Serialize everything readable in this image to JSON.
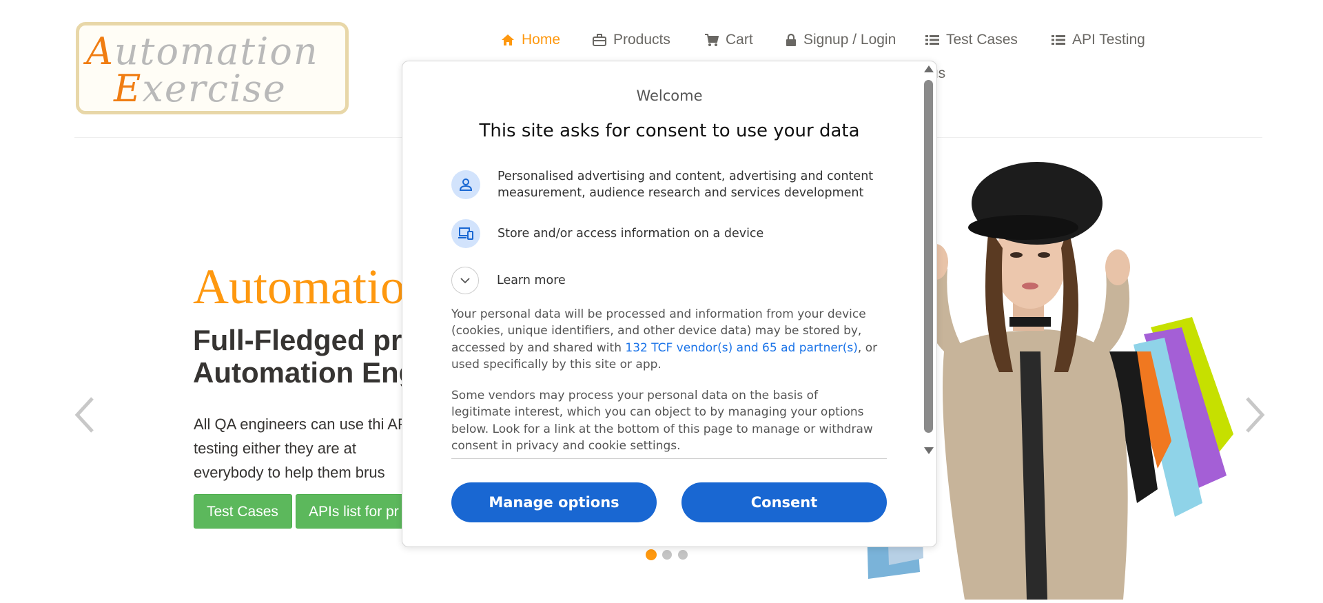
{
  "logo": {
    "line1_first": "A",
    "line1_rest": "utomation",
    "line2_first": "E",
    "line2_rest": "xercise"
  },
  "nav": {
    "items": [
      {
        "label": "Home",
        "icon": "home-icon"
      },
      {
        "label": "Products",
        "icon": "briefcase-icon"
      },
      {
        "label": "Cart",
        "icon": "cart-icon"
      },
      {
        "label": "Signup / Login",
        "icon": "lock-icon"
      },
      {
        "label": "Test Cases",
        "icon": "list-icon"
      },
      {
        "label": "API Testing",
        "icon": "list-icon"
      }
    ],
    "overflow_fragment": "us"
  },
  "hero": {
    "title": "Automatio",
    "subtitle": "Full-Fledged pra Automation Eng",
    "text": "All QA engineers can use thi API testing either they are at everybody to help them brus",
    "buttons": {
      "test_cases": "Test Cases",
      "apis_list": "APIs list for pr"
    }
  },
  "consent": {
    "welcome": "Welcome",
    "heading": "This site asks for consent to use your data",
    "purposes": [
      {
        "icon": "person-icon",
        "text": "Personalised advertising and content, advertising and content measurement, audience research and services development"
      },
      {
        "icon": "devices-icon",
        "text": "Store and/or access information on a device"
      }
    ],
    "learn_more": "Learn more",
    "para1_before": "Your personal data will be processed and information from your device (cookies, unique identifiers, and other device data) may be stored by, accessed by and shared with ",
    "para1_link": "132 TCF vendor(s) and 65 ad partner(s)",
    "para1_after": ", or used specifically by this site or app.",
    "para2": "Some vendors may process your personal data on the basis of legitimate interest, which you can object to by managing your options below. Look for a link at the bottom of this page to manage or withdraw consent in privacy and cookie settings.",
    "manage_button": "Manage options",
    "consent_button": "Consent"
  },
  "carousel": {
    "slide_count": 3,
    "active_index": 0
  },
  "colors": {
    "accent": "#fe980f",
    "green": "#5cb85c",
    "consent_blue": "#1967d2",
    "link_blue": "#1a73e8"
  }
}
